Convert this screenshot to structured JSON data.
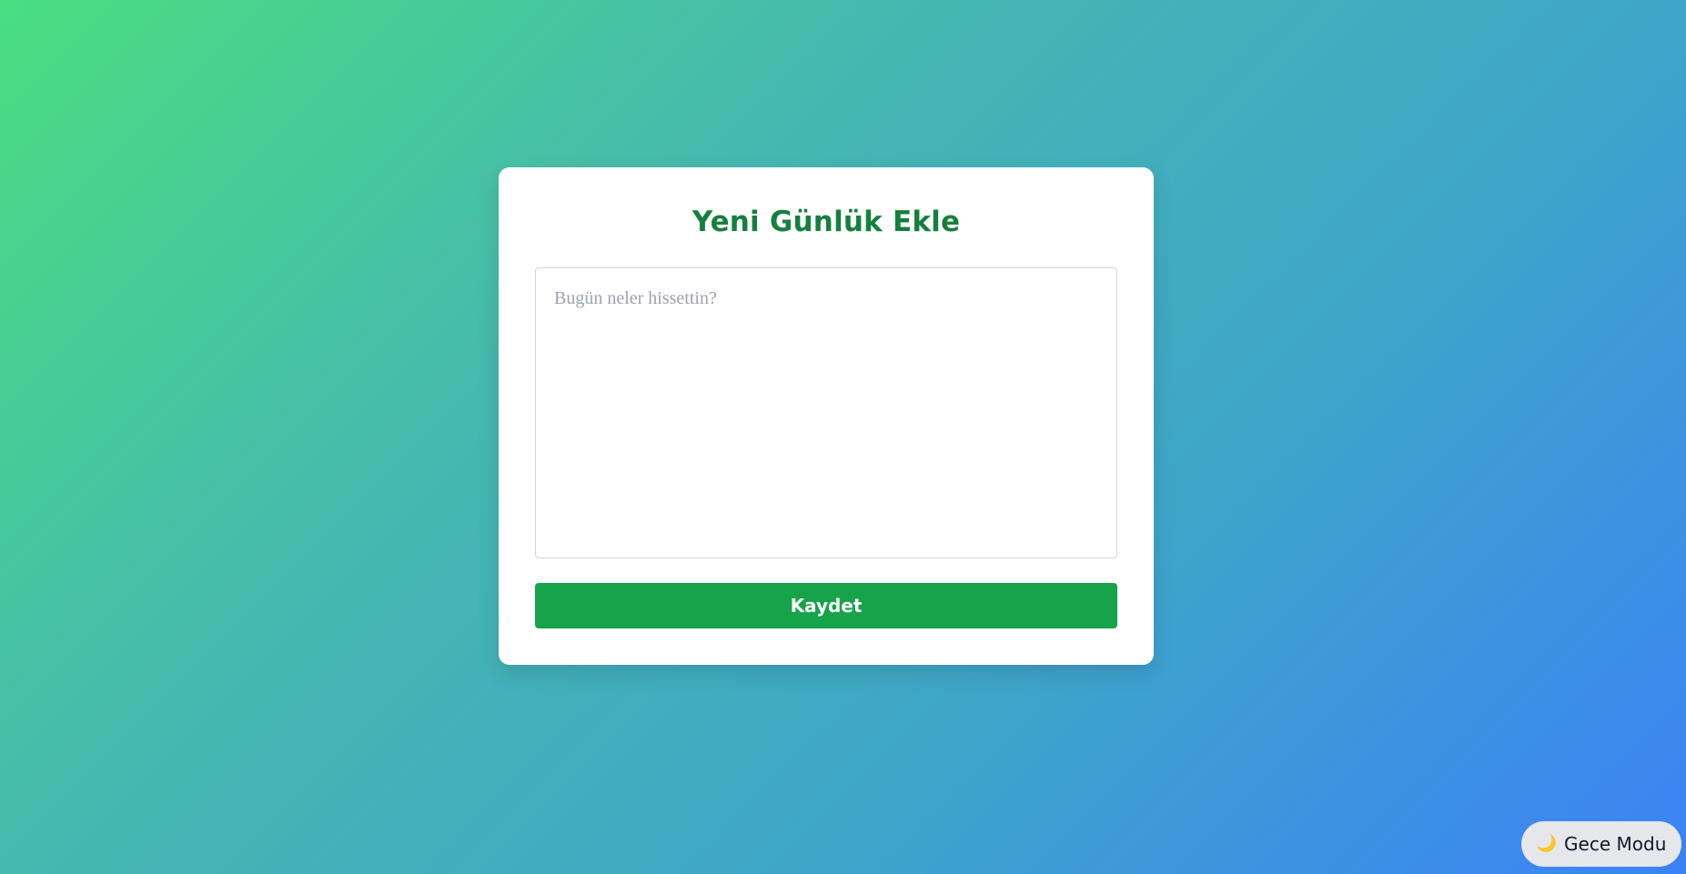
{
  "form": {
    "title": "Yeni Günlük Ekle",
    "entry_placeholder": "Bugün neler hissettin?",
    "entry_value": "",
    "save_label": "Kaydet"
  },
  "theme_toggle": {
    "icon": "crescent-moon-icon",
    "icon_glyph": "🌙",
    "label": "Gece Modu"
  },
  "colors": {
    "accent": "#16a34a",
    "title": "#15803d",
    "gradient_start": "#4ade80",
    "gradient_end": "#3b82f6"
  }
}
